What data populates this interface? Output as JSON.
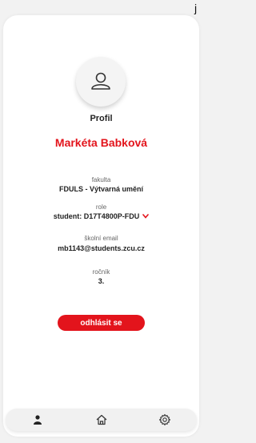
{
  "corner": {
    "text": "j"
  },
  "profile": {
    "title": "Profil",
    "name": "Markéta Babková",
    "faculty_label": "fakulta",
    "faculty_value": "FDULS - Výtvarná umění",
    "role_label": "role",
    "role_value": "student: D17T4800P-FDU",
    "email_label": "školní email",
    "email_value": "mb1143@students.zcu.cz",
    "year_label": "ročník",
    "year_value": "3."
  },
  "actions": {
    "logout_label": "odhlásit se"
  },
  "nav": {
    "items": [
      {
        "icon": "person-icon"
      },
      {
        "icon": "home-icon"
      },
      {
        "icon": "gear-icon"
      }
    ]
  },
  "colors": {
    "accent": "#e3141c",
    "background": "#f2f2f2",
    "card": "#ffffff"
  }
}
